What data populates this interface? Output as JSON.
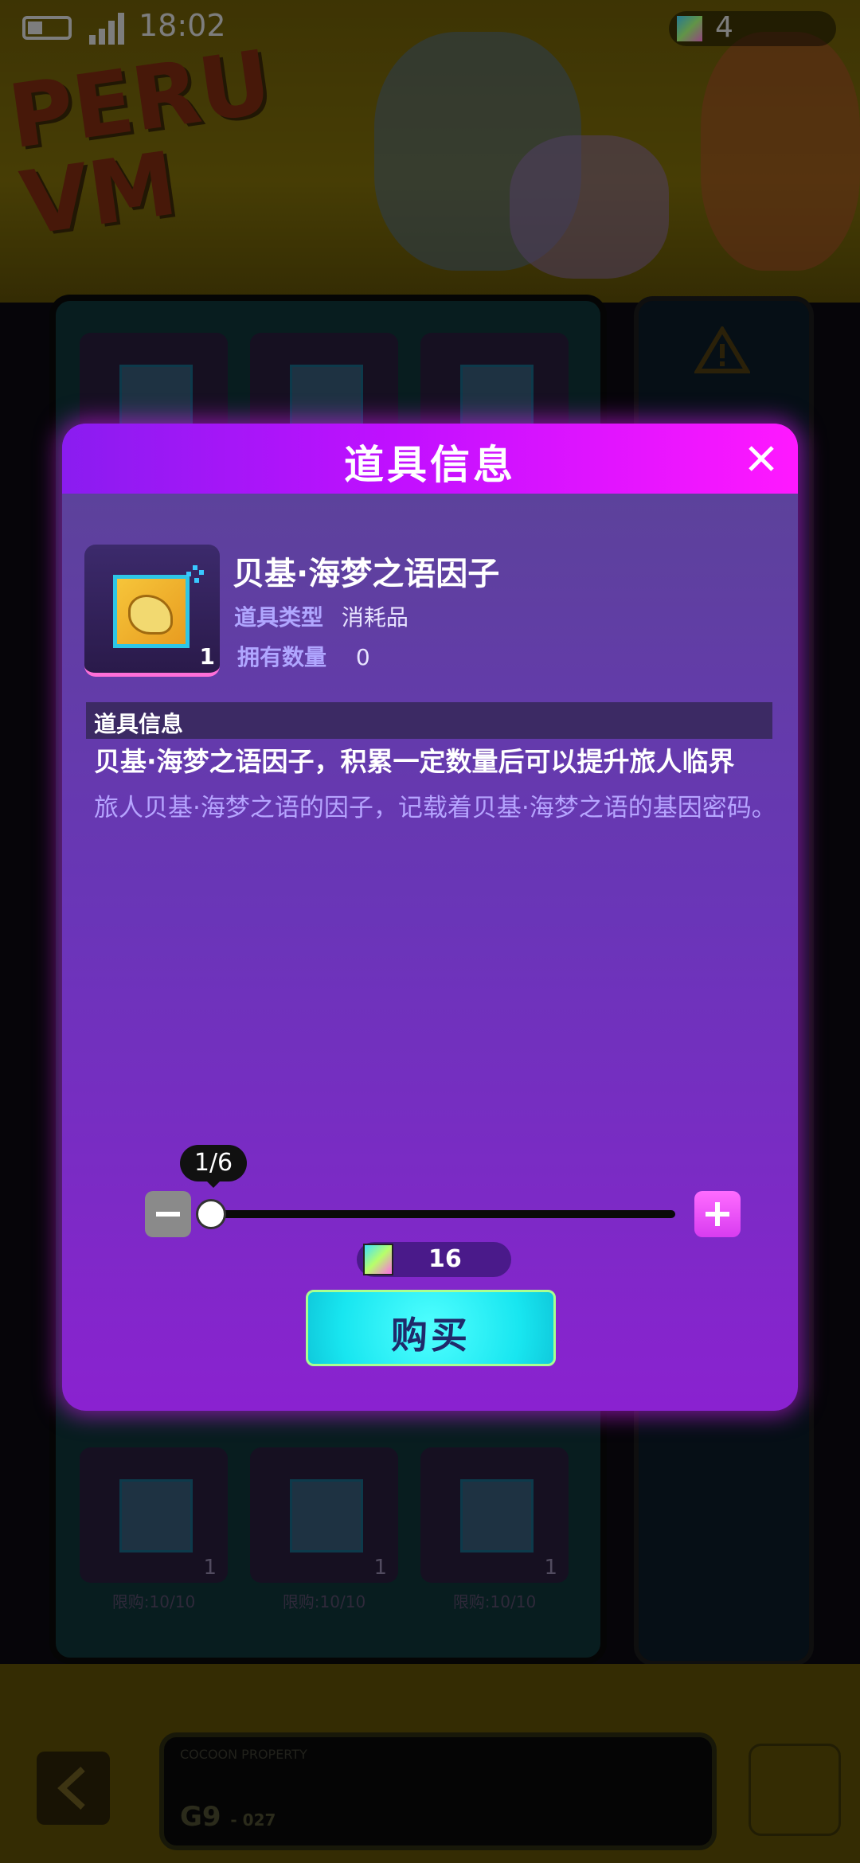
{
  "status_bar": {
    "time": "18:02",
    "currency_amount": "4"
  },
  "background": {
    "logo_text": "PERU VM",
    "shop_cards": [
      {
        "count": "1",
        "limit": "限购:10/10"
      },
      {
        "count": "1",
        "limit": "限购:10/10"
      },
      {
        "count": "1",
        "limit": "限购:10/10"
      }
    ],
    "property_label": "COCOON PROPERTY",
    "property_code": "G9",
    "property_sub": "- 027"
  },
  "modal": {
    "title": "道具信息",
    "item": {
      "name": "贝基·海梦之语因子",
      "type_label": "道具类型",
      "type_value": "消耗品",
      "owned_label": "拥有数量",
      "owned_value": "0",
      "icon_count": "1"
    },
    "section_title": "道具信息",
    "description_main": "贝基·海梦之语因子，积累一定数量后可以提升旅人临界",
    "description_sub": "旅人贝基·海梦之语的因子，记载着贝基·海梦之语的基因密码。",
    "quantity": {
      "current": 1,
      "max": 6,
      "display": "1/6"
    },
    "price": "16",
    "buy_label": "购买"
  },
  "colors": {
    "header_start": "#8a1cf0",
    "header_end": "#ff18ff",
    "buy_button": "#18e6f0",
    "accent_pink": "#ff6fd8"
  }
}
